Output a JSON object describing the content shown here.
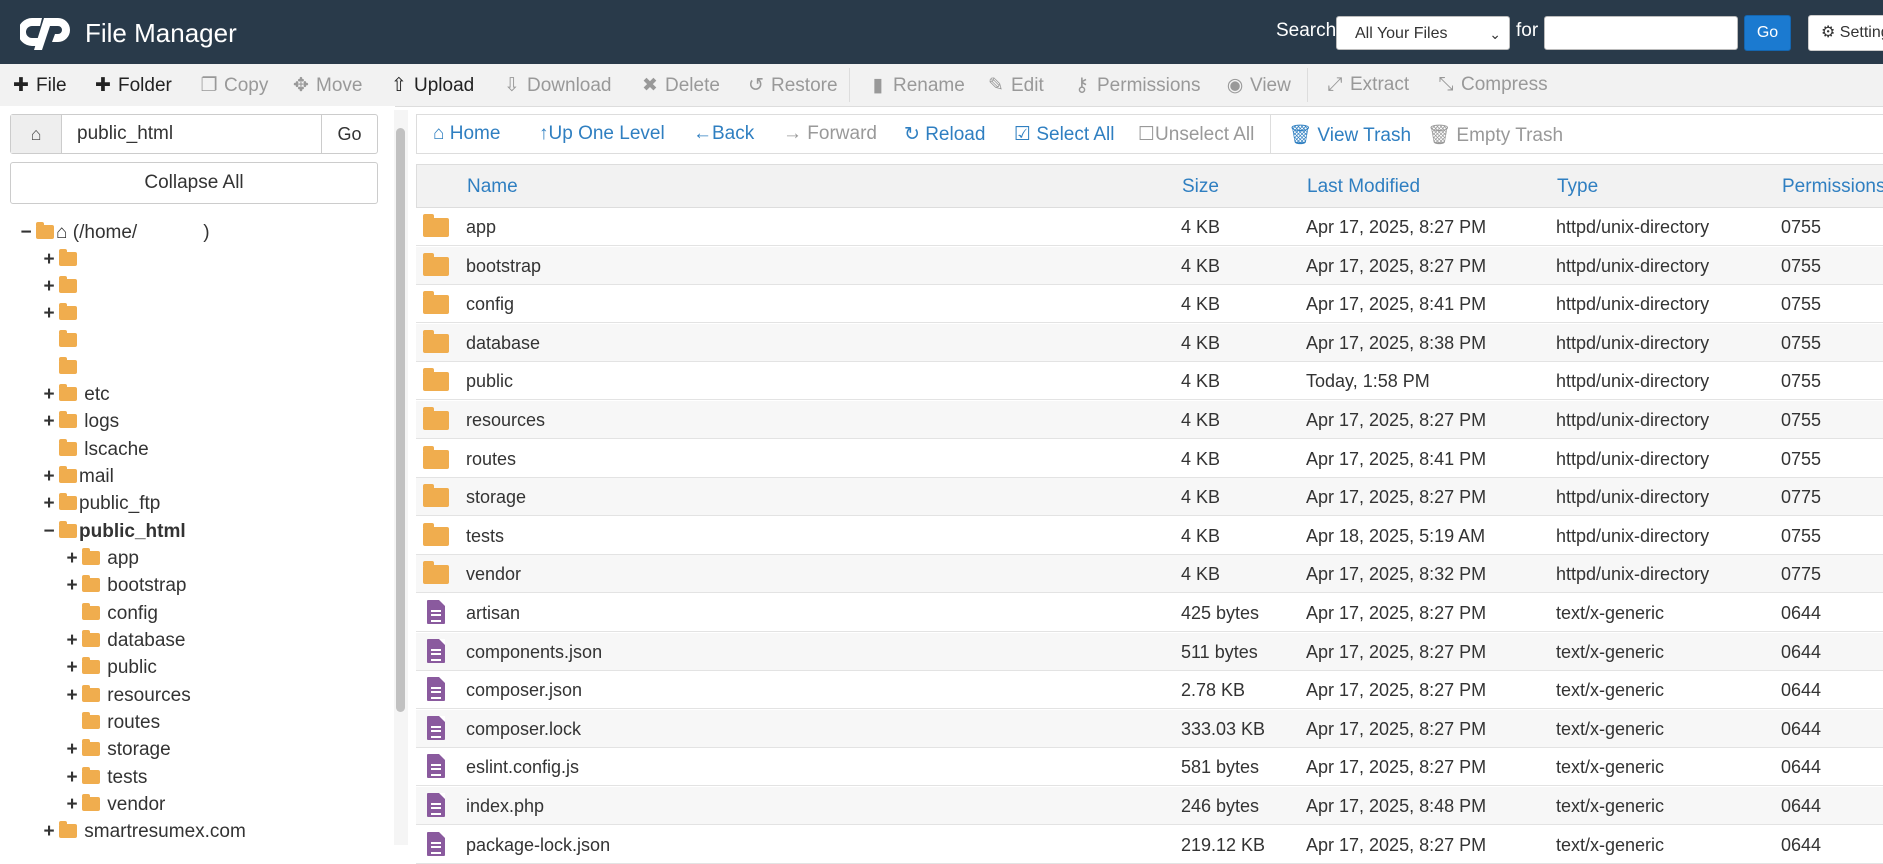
{
  "header": {
    "title": "File Manager",
    "search_label": "Search",
    "search_scope": "All Your Files",
    "for_label": "for",
    "search_value": "",
    "go_label": "Go",
    "settings_label": "Settings"
  },
  "toolbar": {
    "file": "File",
    "folder": "Folder",
    "copy": "Copy",
    "move": "Move",
    "upload": "Upload",
    "download": "Download",
    "delete": "Delete",
    "restore": "Restore",
    "rename": "Rename",
    "edit": "Edit",
    "permissions": "Permissions",
    "view": "View",
    "extract": "Extract",
    "compress": "Compress"
  },
  "sidebar": {
    "path_value": "public_html",
    "go_label": "Go",
    "collapse_label": "Collapse All",
    "root_label": "(/home/",
    "root_suffix": ")",
    "top_items": [
      "etc",
      "logs",
      "lscache",
      "mail",
      "public_ftp",
      "public_html"
    ],
    "public_html_children": [
      "app",
      "bootstrap",
      "config",
      "database",
      "public",
      "resources",
      "routes",
      "storage",
      "tests",
      "vendor"
    ],
    "last_item": "smartresumex.com"
  },
  "nav": {
    "home": "Home",
    "up": "Up One Level",
    "back": "Back",
    "forward": "Forward",
    "reload": "Reload",
    "select_all": "Select All",
    "unselect_all": "Unselect All",
    "view_trash": "View Trash",
    "empty_trash": "Empty Trash"
  },
  "table": {
    "headers": {
      "name": "Name",
      "size": "Size",
      "modified": "Last Modified",
      "type": "Type",
      "permissions": "Permissions"
    },
    "rows": [
      {
        "kind": "folder",
        "name": "app",
        "size": "4 KB",
        "modified": "Apr 17, 2025, 8:27 PM",
        "type": "httpd/unix-directory",
        "perm": "0755"
      },
      {
        "kind": "folder",
        "name": "bootstrap",
        "size": "4 KB",
        "modified": "Apr 17, 2025, 8:27 PM",
        "type": "httpd/unix-directory",
        "perm": "0755"
      },
      {
        "kind": "folder",
        "name": "config",
        "size": "4 KB",
        "modified": "Apr 17, 2025, 8:41 PM",
        "type": "httpd/unix-directory",
        "perm": "0755"
      },
      {
        "kind": "folder",
        "name": "database",
        "size": "4 KB",
        "modified": "Apr 17, 2025, 8:38 PM",
        "type": "httpd/unix-directory",
        "perm": "0755"
      },
      {
        "kind": "folder",
        "name": "public",
        "size": "4 KB",
        "modified": "Today, 1:58 PM",
        "type": "httpd/unix-directory",
        "perm": "0755"
      },
      {
        "kind": "folder",
        "name": "resources",
        "size": "4 KB",
        "modified": "Apr 17, 2025, 8:27 PM",
        "type": "httpd/unix-directory",
        "perm": "0755"
      },
      {
        "kind": "folder",
        "name": "routes",
        "size": "4 KB",
        "modified": "Apr 17, 2025, 8:41 PM",
        "type": "httpd/unix-directory",
        "perm": "0755"
      },
      {
        "kind": "folder",
        "name": "storage",
        "size": "4 KB",
        "modified": "Apr 17, 2025, 8:27 PM",
        "type": "httpd/unix-directory",
        "perm": "0775"
      },
      {
        "kind": "folder",
        "name": "tests",
        "size": "4 KB",
        "modified": "Apr 18, 2025, 5:19 AM",
        "type": "httpd/unix-directory",
        "perm": "0755"
      },
      {
        "kind": "folder",
        "name": "vendor",
        "size": "4 KB",
        "modified": "Apr 17, 2025, 8:32 PM",
        "type": "httpd/unix-directory",
        "perm": "0775"
      },
      {
        "kind": "file",
        "name": "artisan",
        "size": "425 bytes",
        "modified": "Apr 17, 2025, 8:27 PM",
        "type": "text/x-generic",
        "perm": "0644"
      },
      {
        "kind": "file",
        "name": "components.json",
        "size": "511 bytes",
        "modified": "Apr 17, 2025, 8:27 PM",
        "type": "text/x-generic",
        "perm": "0644"
      },
      {
        "kind": "file",
        "name": "composer.json",
        "size": "2.78 KB",
        "modified": "Apr 17, 2025, 8:27 PM",
        "type": "text/x-generic",
        "perm": "0644"
      },
      {
        "kind": "file",
        "name": "composer.lock",
        "size": "333.03 KB",
        "modified": "Apr 17, 2025, 8:27 PM",
        "type": "text/x-generic",
        "perm": "0644"
      },
      {
        "kind": "file",
        "name": "eslint.config.js",
        "size": "581 bytes",
        "modified": "Apr 17, 2025, 8:27 PM",
        "type": "text/x-generic",
        "perm": "0644"
      },
      {
        "kind": "file",
        "name": "index.php",
        "size": "246 bytes",
        "modified": "Apr 17, 2025, 8:48 PM",
        "type": "text/x-generic",
        "perm": "0644"
      },
      {
        "kind": "file",
        "name": "package-lock.json",
        "size": "219.12 KB",
        "modified": "Apr 17, 2025, 8:27 PM",
        "type": "text/x-generic",
        "perm": "0644"
      }
    ]
  },
  "colors": {
    "header_bg": "#293a4a",
    "link_blue": "#2f7fc1",
    "folder": "#f0ad4e",
    "file": "#8a5a9e",
    "go_blue": "#1b7ad0"
  }
}
